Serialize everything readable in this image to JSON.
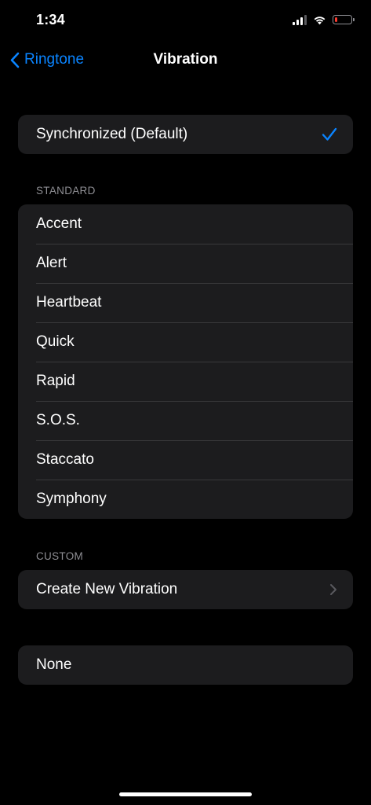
{
  "status_bar": {
    "time": "1:34"
  },
  "nav": {
    "back_label": "Ringtone",
    "title": "Vibration"
  },
  "default_group": {
    "label": "Synchronized (Default)",
    "selected": true
  },
  "standard": {
    "header": "STANDARD",
    "items": [
      "Accent",
      "Alert",
      "Heartbeat",
      "Quick",
      "Rapid",
      "S.O.S.",
      "Staccato",
      "Symphony"
    ]
  },
  "custom": {
    "header": "CUSTOM",
    "create_label": "Create New Vibration"
  },
  "none_group": {
    "label": "None"
  },
  "colors": {
    "accent": "#0a84ff",
    "background": "#000000",
    "cell": "#1c1c1e",
    "separator": "#38383a",
    "secondary_text": "#8e8e93",
    "battery_low": "#ff3b30"
  },
  "icons": {
    "back": "chevron-left-icon",
    "check": "checkmark-icon",
    "disclosure": "chevron-right-icon",
    "signal": "cellular-signal-icon",
    "wifi": "wifi-icon",
    "battery": "battery-icon"
  },
  "battery_level": 0.15
}
